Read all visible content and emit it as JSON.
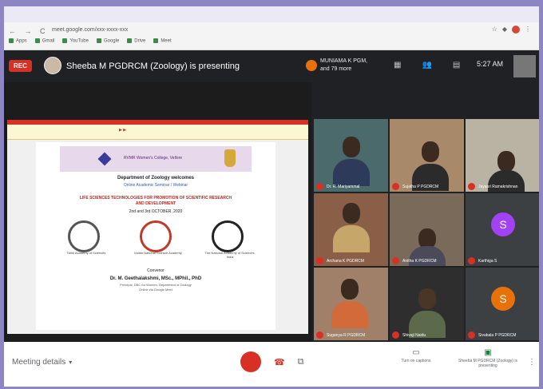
{
  "browser": {
    "nav": "← → C",
    "url": "meet.google.com/xxx-xxxx-xxx",
    "bookmarks": [
      "Apps",
      "Gmail",
      "YouTube",
      "Google",
      "Drive",
      "Meet"
    ]
  },
  "meet": {
    "rec_label": "REC",
    "presenter_text": "Sheeba M PGDRCM (Zoology) is presenting",
    "joined_text": "MUNIAMA K PGM, and 79 more",
    "clock": "5:27 AM"
  },
  "slide": {
    "college": "RVMR Women's College, Vellore",
    "department": "Department of Zoology welcomes",
    "subtitle": "Online Academic Seminar / Webinar",
    "title_line1": "LIFE SCIENCES TECHNOLOGIES FOR PROMOTION OF SCIENTIFIC RESEARCH",
    "title_line2": "AND DEVELOPMENT",
    "date": "2nd and 3rd OCTOBER, 2020",
    "logo_captions": [
      "Tamil Academy of Sciences",
      "Indian National Science Academy",
      "The National Academy of Sciences, India"
    ],
    "convenor_label": "Convenor",
    "convenor_name": "Dr. M. Geethalakshmi, MSc., MPhil., PhD",
    "convenor_line1": "Principal, DBC for Women, Department of Zoology",
    "convenor_line2": "Online via Google Meet"
  },
  "tiles": [
    {
      "name": "Dr. R. Mariyammal",
      "kind": "video"
    },
    {
      "name": "Sujatha P PGDRCM",
      "kind": "video"
    },
    {
      "name": "Jayasri Ramakrishnan",
      "kind": "video"
    },
    {
      "name": "Archana K PGDRCM",
      "kind": "video"
    },
    {
      "name": "Anitha K PGDRCM",
      "kind": "video"
    },
    {
      "name": "Karthiga S",
      "kind": "letter",
      "letter": "S",
      "color": "#a142f4"
    },
    {
      "name": "Suganya R PGDRCM",
      "kind": "video"
    },
    {
      "name": "Shivaji Naidu",
      "kind": "video"
    },
    {
      "name": "Sivabala P PGDRCM",
      "kind": "letter",
      "letter": "S",
      "color": "#e8710a"
    }
  ],
  "controls": {
    "meeting_details": "Meeting details",
    "captions_label": "Turn on captions",
    "presenting_label": "Sheeba M PGDRCM (Zoology) is presenting"
  },
  "colors": {
    "accent_red": "#d93025",
    "frame": "#8e86c4",
    "meet_bg": "#202124"
  }
}
